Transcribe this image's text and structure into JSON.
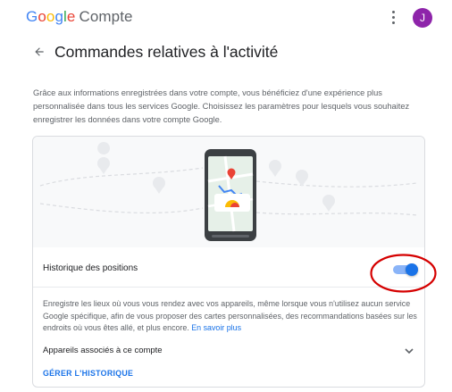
{
  "header": {
    "brand_letters": [
      "G",
      "o",
      "o",
      "g",
      "l",
      "e"
    ],
    "product": "Compte",
    "avatar_letter": "J",
    "menu_icon": "more-vert-icon",
    "colors": {
      "blue": "#4285f4",
      "red": "#ea4335",
      "yellow": "#fbbc05",
      "green": "#34a853",
      "avatar": "#8e24aa"
    }
  },
  "page": {
    "back_icon": "arrow-back-icon",
    "title": "Commandes relatives à l'activité",
    "intro": "Grâce aux informations enregistrées dans votre compte, vous bénéficiez d'une expérience plus personnalisée dans tous les services Google. Choisissez les paramètres pour lesquels vous souhaitez enregistrer les données dans votre compte Google."
  },
  "card": {
    "illustration_icon": "phone-map-illustration",
    "setting_label": "Historique des positions",
    "toggle_on": true,
    "accent": "#1a73e8",
    "highlight_color": "#d50000",
    "description": "Enregistre les lieux où vous vous rendez avec vos appareils, même lorsque vous n'utilisez aucun service Google spécifique, afin de vous proposer des cartes personnalisées, des recommandations basées sur les endroits où vous êtes allé, et plus encore.",
    "learn_more": "En savoir plus",
    "devices_label": "Appareils associés à ce compte",
    "manage_label": "GÉRER L'HISTORIQUE"
  }
}
